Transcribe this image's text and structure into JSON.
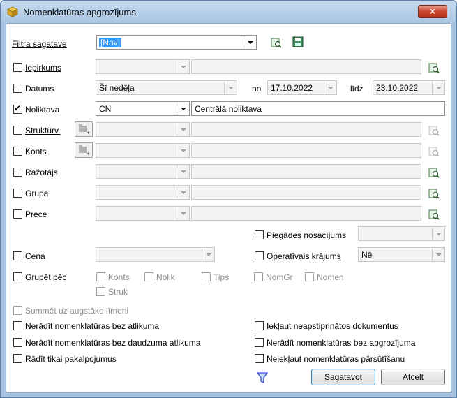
{
  "window": {
    "title": "Nomenklatūras apgrozījums",
    "close_label": "✕"
  },
  "filter_template": {
    "label": "Filtra sagatave",
    "value": "[Nav]"
  },
  "rows": {
    "iepirkums": {
      "label": "Iepirkums"
    },
    "datums": {
      "label": "Datums",
      "period": "Šī nedēļa",
      "from_label": "no",
      "from": "17.10.2022",
      "to_label": "līdz",
      "to": "23.10.2022"
    },
    "noliktava": {
      "label": "Noliktava",
      "code": "CN",
      "name": "Centrālā noliktava"
    },
    "strukturv": {
      "label": "Struktūrv."
    },
    "konts": {
      "label": "Konts"
    },
    "razotajs": {
      "label": "Ražotājs"
    },
    "grupa": {
      "label": "Grupa"
    },
    "prece": {
      "label": "Prece"
    }
  },
  "piegades": {
    "label": "Piegādes nosacījums",
    "value": ""
  },
  "cena": {
    "label": "Cena"
  },
  "operativais": {
    "label": "Operatīvais krājums",
    "value": "Nē"
  },
  "grupet": {
    "label": "Grupēt pēc",
    "options": [
      "Konts",
      "Nolik",
      "Tips",
      "NomGr",
      "Nomen",
      "Struk"
    ]
  },
  "options": {
    "summet": "Summēt uz augstāko līmeni",
    "neradit_bez_atlikuma": "Nerādīt nomenklatūras bez atlikuma",
    "neradit_bez_daudzuma": "Nerādīt nomenklatūras bez daudzuma atlikuma",
    "radit_pakalpojumus": "Rādīt tikai pakalpojumus",
    "ieklaut_neapstiprinatos": "Iekļaut neapstiprinātos dokumentus",
    "neradit_bez_apgrozijuma": "Nerādīt nomenklatūras bez apgrozījuma",
    "neieklaut_parsutisanu": "Neiekļaut nomenklatūras pārsūtīšanu"
  },
  "buttons": {
    "ok": "Sagatavot",
    "cancel": "Atcelt"
  }
}
